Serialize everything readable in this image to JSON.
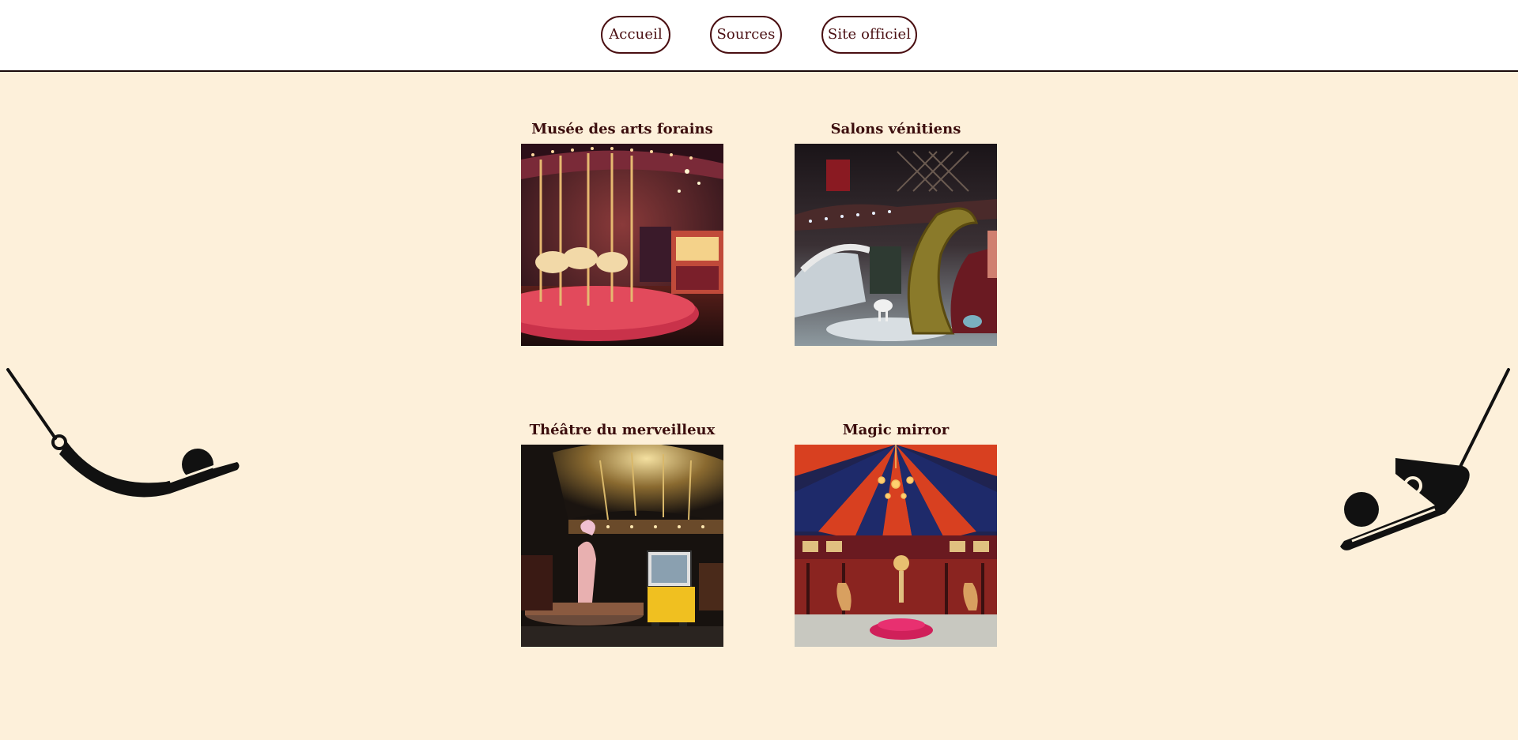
{
  "nav": {
    "items": [
      {
        "label": "Accueil"
      },
      {
        "label": "Sources"
      },
      {
        "label": "Site officiel"
      }
    ]
  },
  "gallery": {
    "items": [
      {
        "title": "Musée des arts forains",
        "image": "carousel-photo"
      },
      {
        "title": "Salons vénitiens",
        "image": "venetian-salon-photo"
      },
      {
        "title": "Théâtre du merveilleux",
        "image": "theatre-photo"
      },
      {
        "title": "Magic mirror",
        "image": "magic-mirror-tent-photo"
      }
    ]
  },
  "decor": {
    "left": "trapeze-artist-icon",
    "right": "trapeze-artist-icon"
  },
  "colors": {
    "background": "#fdf0da",
    "header_background": "#ffffff",
    "accent": "#4a0f12",
    "text": "#3b0d0d"
  }
}
